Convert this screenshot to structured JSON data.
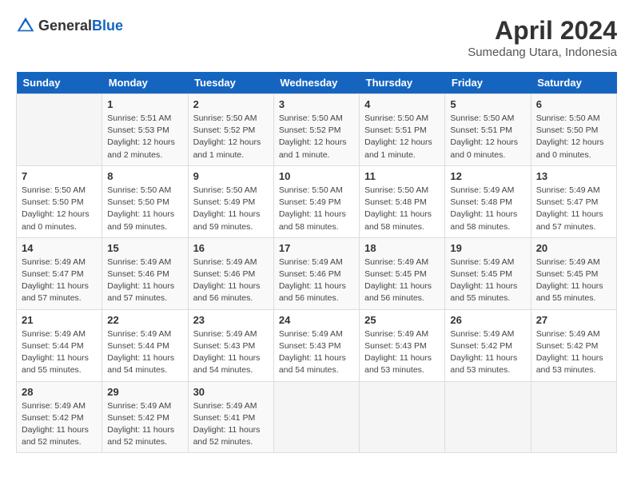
{
  "header": {
    "logo_general": "General",
    "logo_blue": "Blue",
    "title": "April 2024",
    "subtitle": "Sumedang Utara, Indonesia"
  },
  "calendar": {
    "weekdays": [
      "Sunday",
      "Monday",
      "Tuesday",
      "Wednesday",
      "Thursday",
      "Friday",
      "Saturday"
    ],
    "weeks": [
      [
        {
          "day": "",
          "info": ""
        },
        {
          "day": "1",
          "info": "Sunrise: 5:51 AM\nSunset: 5:53 PM\nDaylight: 12 hours\nand 2 minutes."
        },
        {
          "day": "2",
          "info": "Sunrise: 5:50 AM\nSunset: 5:52 PM\nDaylight: 12 hours\nand 1 minute."
        },
        {
          "day": "3",
          "info": "Sunrise: 5:50 AM\nSunset: 5:52 PM\nDaylight: 12 hours\nand 1 minute."
        },
        {
          "day": "4",
          "info": "Sunrise: 5:50 AM\nSunset: 5:51 PM\nDaylight: 12 hours\nand 1 minute."
        },
        {
          "day": "5",
          "info": "Sunrise: 5:50 AM\nSunset: 5:51 PM\nDaylight: 12 hours\nand 0 minutes."
        },
        {
          "day": "6",
          "info": "Sunrise: 5:50 AM\nSunset: 5:50 PM\nDaylight: 12 hours\nand 0 minutes."
        }
      ],
      [
        {
          "day": "7",
          "info": "Sunrise: 5:50 AM\nSunset: 5:50 PM\nDaylight: 12 hours\nand 0 minutes."
        },
        {
          "day": "8",
          "info": "Sunrise: 5:50 AM\nSunset: 5:50 PM\nDaylight: 11 hours\nand 59 minutes."
        },
        {
          "day": "9",
          "info": "Sunrise: 5:50 AM\nSunset: 5:49 PM\nDaylight: 11 hours\nand 59 minutes."
        },
        {
          "day": "10",
          "info": "Sunrise: 5:50 AM\nSunset: 5:49 PM\nDaylight: 11 hours\nand 58 minutes."
        },
        {
          "day": "11",
          "info": "Sunrise: 5:50 AM\nSunset: 5:48 PM\nDaylight: 11 hours\nand 58 minutes."
        },
        {
          "day": "12",
          "info": "Sunrise: 5:49 AM\nSunset: 5:48 PM\nDaylight: 11 hours\nand 58 minutes."
        },
        {
          "day": "13",
          "info": "Sunrise: 5:49 AM\nSunset: 5:47 PM\nDaylight: 11 hours\nand 57 minutes."
        }
      ],
      [
        {
          "day": "14",
          "info": "Sunrise: 5:49 AM\nSunset: 5:47 PM\nDaylight: 11 hours\nand 57 minutes."
        },
        {
          "day": "15",
          "info": "Sunrise: 5:49 AM\nSunset: 5:46 PM\nDaylight: 11 hours\nand 57 minutes."
        },
        {
          "day": "16",
          "info": "Sunrise: 5:49 AM\nSunset: 5:46 PM\nDaylight: 11 hours\nand 56 minutes."
        },
        {
          "day": "17",
          "info": "Sunrise: 5:49 AM\nSunset: 5:46 PM\nDaylight: 11 hours\nand 56 minutes."
        },
        {
          "day": "18",
          "info": "Sunrise: 5:49 AM\nSunset: 5:45 PM\nDaylight: 11 hours\nand 56 minutes."
        },
        {
          "day": "19",
          "info": "Sunrise: 5:49 AM\nSunset: 5:45 PM\nDaylight: 11 hours\nand 55 minutes."
        },
        {
          "day": "20",
          "info": "Sunrise: 5:49 AM\nSunset: 5:45 PM\nDaylight: 11 hours\nand 55 minutes."
        }
      ],
      [
        {
          "day": "21",
          "info": "Sunrise: 5:49 AM\nSunset: 5:44 PM\nDaylight: 11 hours\nand 55 minutes."
        },
        {
          "day": "22",
          "info": "Sunrise: 5:49 AM\nSunset: 5:44 PM\nDaylight: 11 hours\nand 54 minutes."
        },
        {
          "day": "23",
          "info": "Sunrise: 5:49 AM\nSunset: 5:43 PM\nDaylight: 11 hours\nand 54 minutes."
        },
        {
          "day": "24",
          "info": "Sunrise: 5:49 AM\nSunset: 5:43 PM\nDaylight: 11 hours\nand 54 minutes."
        },
        {
          "day": "25",
          "info": "Sunrise: 5:49 AM\nSunset: 5:43 PM\nDaylight: 11 hours\nand 53 minutes."
        },
        {
          "day": "26",
          "info": "Sunrise: 5:49 AM\nSunset: 5:42 PM\nDaylight: 11 hours\nand 53 minutes."
        },
        {
          "day": "27",
          "info": "Sunrise: 5:49 AM\nSunset: 5:42 PM\nDaylight: 11 hours\nand 53 minutes."
        }
      ],
      [
        {
          "day": "28",
          "info": "Sunrise: 5:49 AM\nSunset: 5:42 PM\nDaylight: 11 hours\nand 52 minutes."
        },
        {
          "day": "29",
          "info": "Sunrise: 5:49 AM\nSunset: 5:42 PM\nDaylight: 11 hours\nand 52 minutes."
        },
        {
          "day": "30",
          "info": "Sunrise: 5:49 AM\nSunset: 5:41 PM\nDaylight: 11 hours\nand 52 minutes."
        },
        {
          "day": "",
          "info": ""
        },
        {
          "day": "",
          "info": ""
        },
        {
          "day": "",
          "info": ""
        },
        {
          "day": "",
          "info": ""
        }
      ]
    ]
  }
}
